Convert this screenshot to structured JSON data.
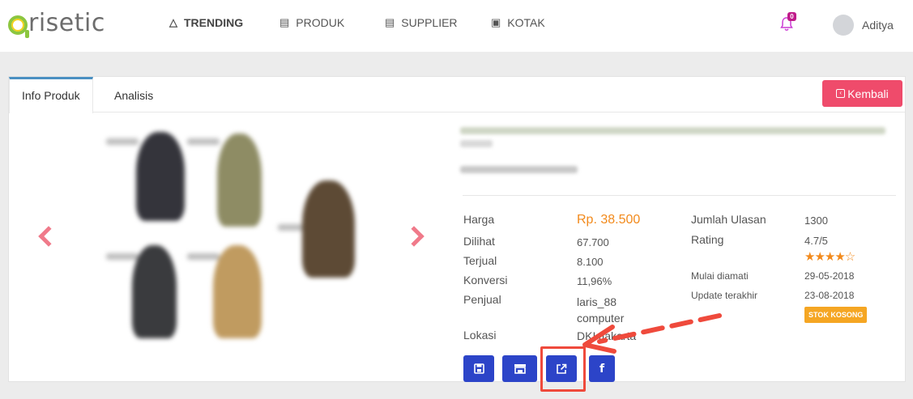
{
  "brand": {
    "name": "risetic"
  },
  "nav": {
    "items": [
      {
        "label": "TRENDING",
        "icon": "flame-icon"
      },
      {
        "label": "PRODUK",
        "icon": "warehouse-icon"
      },
      {
        "label": "SUPPLIER",
        "icon": "store-icon"
      },
      {
        "label": "KOTAK",
        "icon": "box-icon"
      }
    ],
    "notifications": "0",
    "username": "Aditya"
  },
  "tabs": [
    "Info Produk",
    "Analisis"
  ],
  "back_button": "Kembali",
  "product": {
    "left": [
      {
        "label": "Harga",
        "value": "Rp. 38.500"
      },
      {
        "label": "Dilihat",
        "value": "67.700"
      },
      {
        "label": "Terjual",
        "value": "8.100"
      },
      {
        "label": "Konversi",
        "value": "11,96%"
      },
      {
        "label": "Penjual",
        "value": "laris_88 computer"
      },
      {
        "label": "Lokasi",
        "value": "DKI Jakarta"
      }
    ],
    "right": [
      {
        "label": "Jumlah Ulasan",
        "value": "1300"
      },
      {
        "label": "Rating",
        "value": "4.7/5"
      },
      {
        "label": "Mulai diamati",
        "value": "29-05-2018"
      },
      {
        "label": "Update terakhir",
        "value": "23-08-2018"
      }
    ],
    "rating_stars": 4.5,
    "stock_status": "STOK KOSONG"
  },
  "actions": [
    "save-icon",
    "store-icon",
    "external-link-icon",
    "facebook-icon"
  ],
  "colors": {
    "accent": "#2c44c8",
    "back": "#ef4b6b",
    "price": "#f28a1c",
    "highlight": "#ef4a3c",
    "bell": "#cc3bd4"
  }
}
